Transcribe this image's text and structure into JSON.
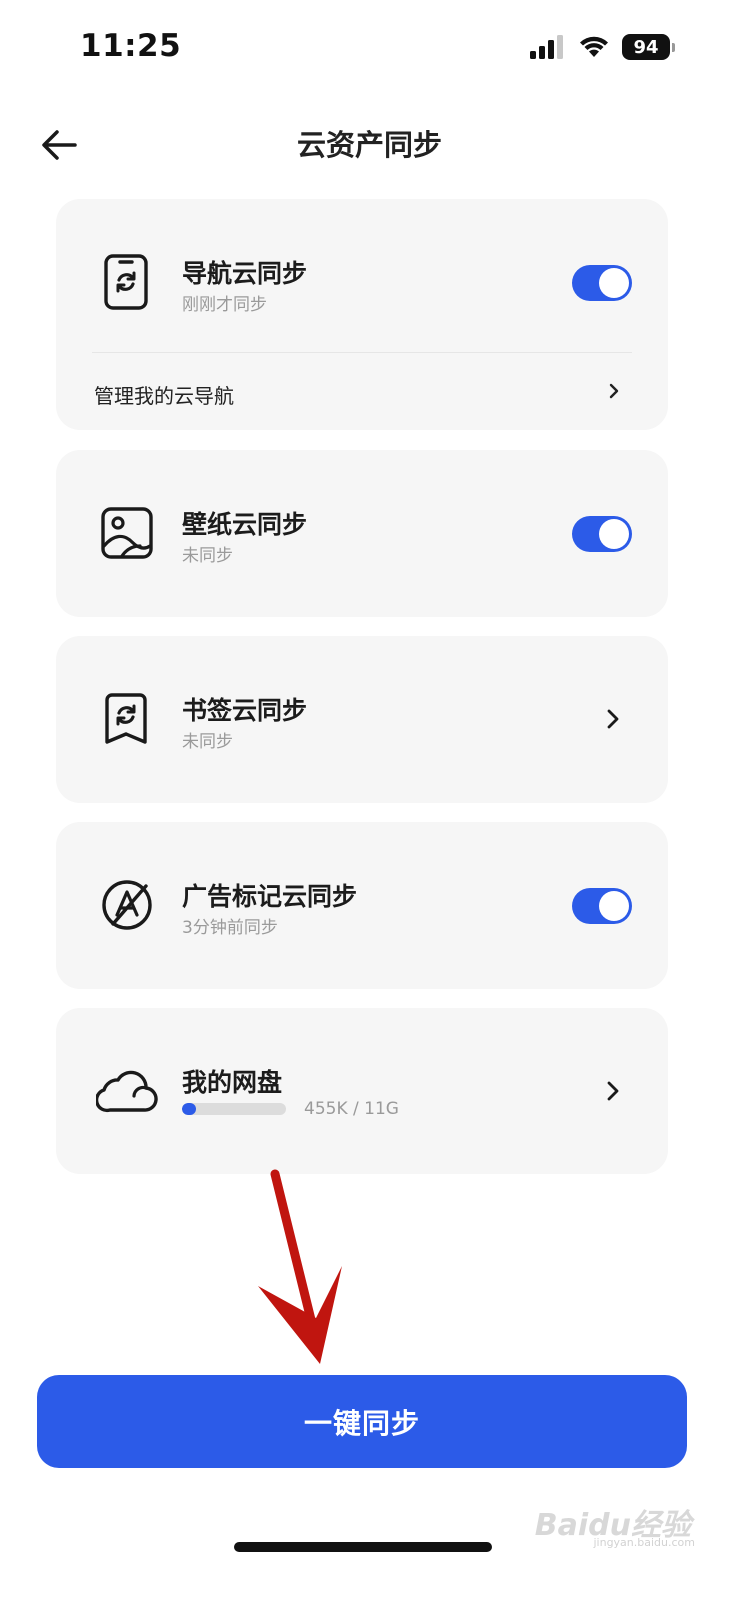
{
  "status_bar": {
    "time": "11:25",
    "battery": "94",
    "icons": [
      "cellular-signal-icon",
      "wifi-icon",
      "battery-icon"
    ]
  },
  "header": {
    "title": "云资产同步",
    "back_icon": "arrow-left-icon"
  },
  "cards": {
    "nav": {
      "icon": "phone-sync-icon",
      "title": "导航云同步",
      "subtitle": "刚刚才同步",
      "toggle_on": true,
      "manage_label": "管理我的云导航"
    },
    "wallpaper": {
      "icon": "image-icon",
      "title": "壁纸云同步",
      "subtitle": "未同步",
      "toggle_on": true
    },
    "bookmark": {
      "icon": "bookmark-sync-icon",
      "title": "书签云同步",
      "subtitle": "未同步"
    },
    "adblock": {
      "icon": "ad-block-icon",
      "title": "广告标记云同步",
      "subtitle": "3分钟前同步",
      "toggle_on": true
    },
    "drive": {
      "icon": "cloud-icon",
      "title": "我的网盘",
      "usage": "455K / 11G",
      "used_fraction": 0.13
    }
  },
  "action": {
    "sync_all_label": "一键同步"
  },
  "colors": {
    "accent": "#2c5be8",
    "card_bg": "#f6f6f6",
    "arrow": "#c0150f"
  },
  "watermark": {
    "text": "Baidu经验",
    "sub": "jingyan.baidu.com"
  }
}
